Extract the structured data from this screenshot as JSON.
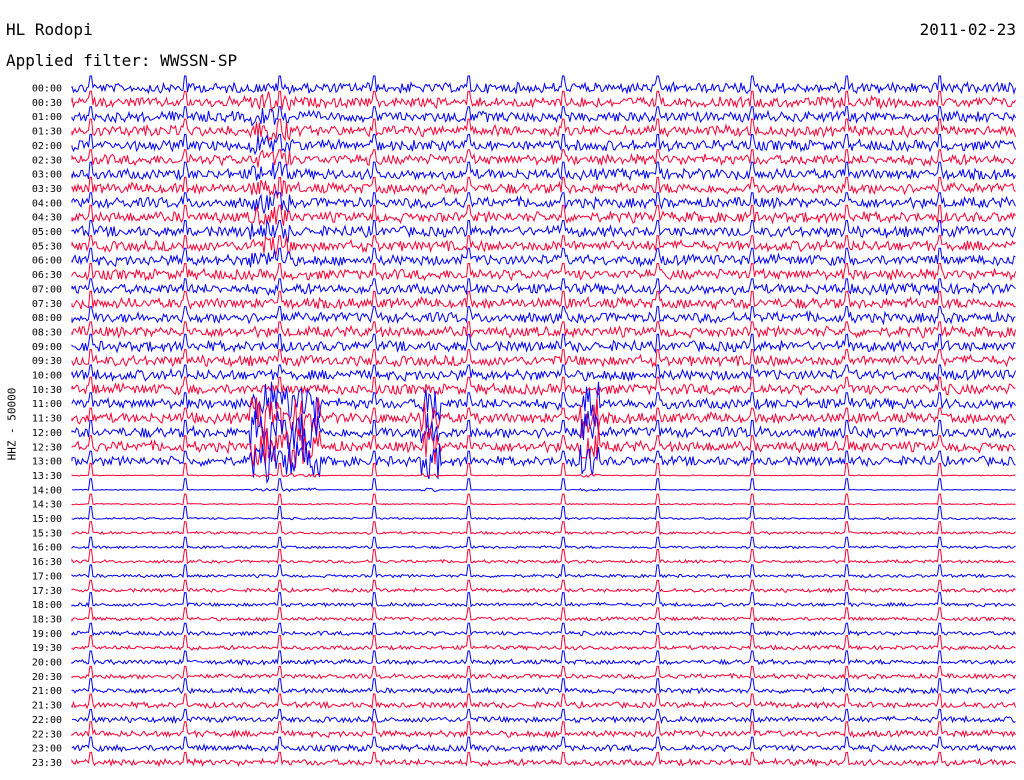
{
  "header": {
    "station": "HL Rodopi",
    "date": "2011-02-23",
    "filter_label": "Applied filter: WWSSN-SP",
    "channel_label": "HHZ - 50000"
  },
  "chart_data": {
    "type": "line",
    "title": "HL Rodopi",
    "subtitle": "Applied filter: WWSSN-SP",
    "ylabel": "HHZ - 50000",
    "categories": [
      "00:00",
      "00:30",
      "01:00",
      "01:30",
      "02:00",
      "02:30",
      "03:00",
      "03:30",
      "04:00",
      "04:30",
      "05:00",
      "05:30",
      "06:00",
      "06:30",
      "07:00",
      "07:30",
      "08:00",
      "08:30",
      "09:00",
      "09:30",
      "10:00",
      "10:30",
      "11:00",
      "11:30",
      "12:00",
      "12:30",
      "13:00",
      "13:30",
      "14:00",
      "14:30",
      "15:00",
      "15:30",
      "16:00",
      "16:30",
      "17:00",
      "17:30",
      "18:00",
      "18:30",
      "19:00",
      "19:30",
      "20:00",
      "20:30",
      "21:00",
      "21:30",
      "22:00",
      "22:30",
      "23:00",
      "23:30"
    ],
    "series_colors": [
      "#0000ff",
      "#ff0033"
    ],
    "noise_amplitude": [
      1,
      1,
      1,
      1,
      1,
      1,
      1,
      1,
      1,
      1,
      1,
      1,
      1,
      1,
      1,
      1,
      1,
      1,
      1,
      1,
      1,
      1,
      1,
      1,
      1,
      1,
      0.9,
      0.08,
      0.08,
      0.12,
      0.2,
      0.25,
      0.25,
      0.3,
      0.3,
      0.35,
      0.35,
      0.35,
      0.4,
      0.4,
      0.45,
      0.45,
      0.5,
      0.55,
      0.55,
      0.6,
      0.6,
      0.6
    ],
    "minute_marks": [
      2,
      12,
      22,
      32,
      42,
      52,
      62,
      72,
      82,
      92
    ]
  }
}
